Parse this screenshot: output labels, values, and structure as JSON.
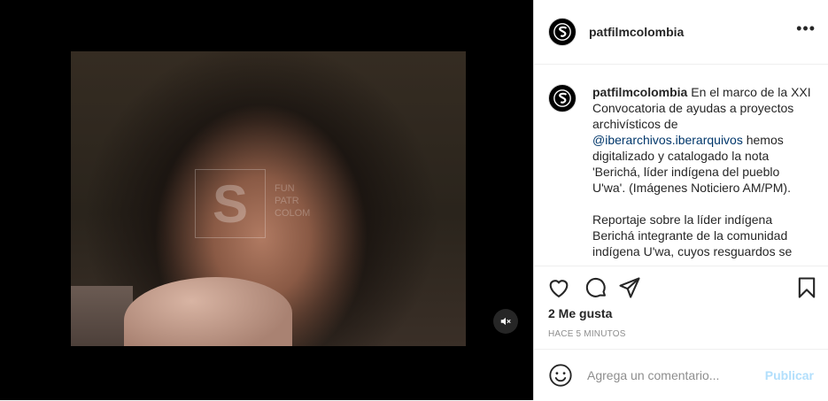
{
  "post": {
    "username": "patfilmcolombia",
    "more_icon": "ellipsis-icon",
    "watermark_glyph": "S",
    "watermark_lines": [
      "FUN",
      "PATR",
      "COLOM"
    ]
  },
  "caption": {
    "username": "patfilmcolombia",
    "text_1a": " En el marco de la XXI Convocatoria de ayudas a proyectos archivísticos de ",
    "mention": "@iberarchivos.iberarquivos",
    "text_1b": " hemos digitalizado y catalogado la nota 'Berichá, líder indígena del pueblo U'wa'. (Imágenes Noticiero AM/PM).",
    "text_2": "Reportaje sobre la líder indígena Berichá integrante de la comunidad indígena U'wa, cuyos resguardos se"
  },
  "engagement": {
    "likes": "2 Me gusta",
    "time_ago": "HACE 5 MINUTOS"
  },
  "comment": {
    "placeholder": "Agrega un comentario...",
    "publish_label": "Publicar"
  },
  "colors": {
    "link": "#00376b",
    "publish_disabled": "#b2dffc",
    "secondary_text": "#8e8e8e"
  }
}
